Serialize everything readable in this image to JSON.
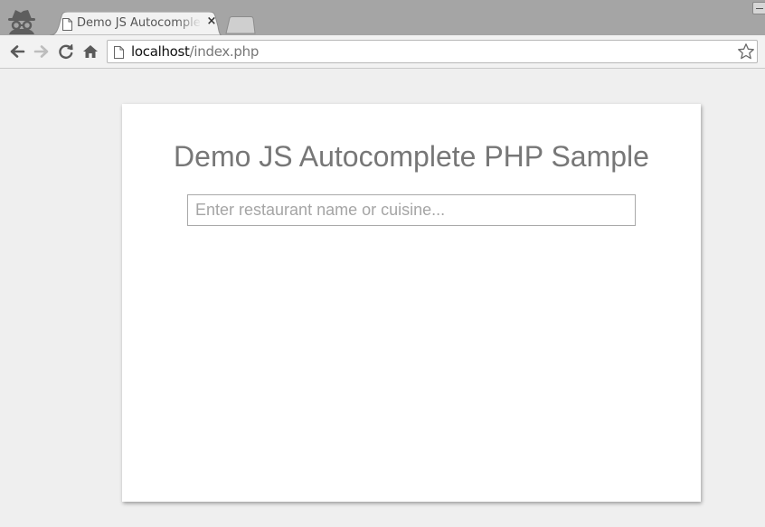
{
  "browser": {
    "tab": {
      "title": "Demo JS Autocomplete PHP Sample",
      "close_glyph": "×"
    },
    "address_bar": {
      "host": "localhost",
      "path": "/index.php"
    },
    "icons": {
      "incognito": "incognito-icon",
      "back": "back-arrow-icon",
      "forward": "forward-arrow-icon",
      "reload": "reload-icon",
      "home": "home-icon",
      "page": "page-icon",
      "bookmark": "star-icon"
    }
  },
  "page": {
    "title": "Demo JS Autocomplete PHP Sample",
    "search": {
      "value": "",
      "placeholder": "Enter restaurant name or cuisine..."
    }
  },
  "colors": {
    "chrome_frame": "#a5a5a5",
    "toolbar": "#f2f2f2",
    "page_background": "#efefef",
    "card": "#ffffff",
    "title_text": "#777777"
  }
}
